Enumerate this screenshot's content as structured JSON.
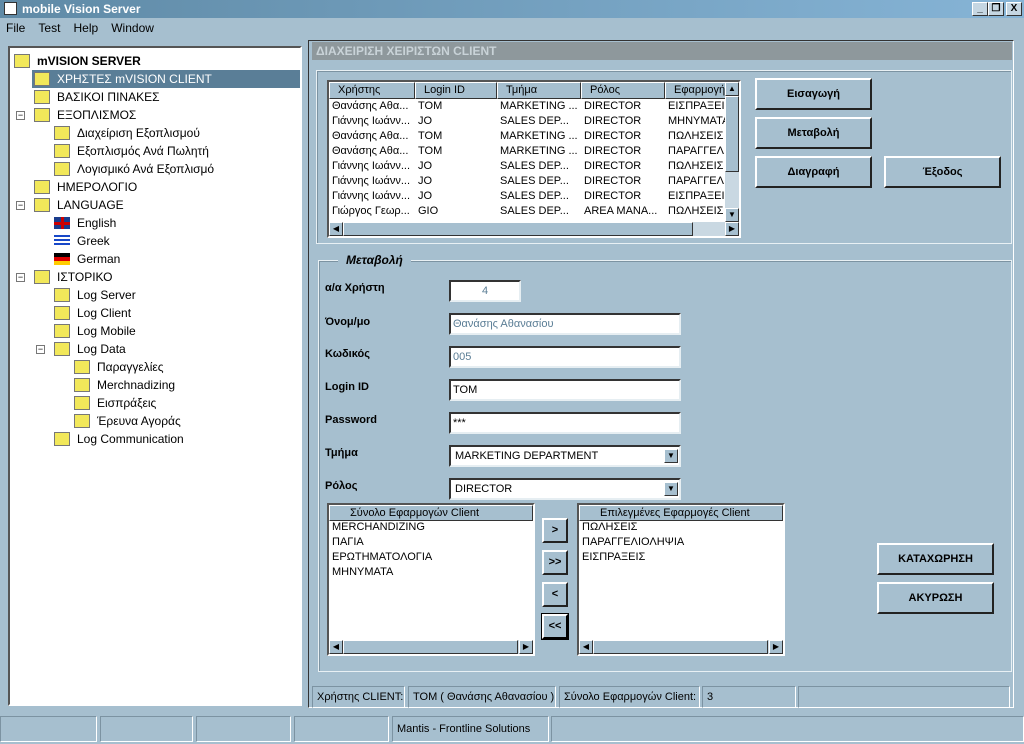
{
  "window": {
    "title": "mobile Vision Server",
    "controls": [
      "_",
      "Ɖ",
      "X"
    ]
  },
  "menu": [
    "File",
    "Test",
    "Help",
    "Window"
  ],
  "tree": [
    {
      "label": "mVISION SERVER",
      "level": 0,
      "bold": true,
      "icon": "folder"
    },
    {
      "label": "ΧΡΗΣΤΕΣ mVISION CLIENT",
      "level": 1,
      "icon": "folder",
      "selected": true
    },
    {
      "label": "ΒΑΣΙΚΟΙ ΠΙΝΑΚΕΣ",
      "level": 1,
      "icon": "folder"
    },
    {
      "label": "ΕΞΟΠΛΙΣΜΟΣ",
      "level": 1,
      "icon": "folder",
      "expanded": true
    },
    {
      "label": "Διαχείριση Εξοπλισμού",
      "level": 2,
      "icon": "folder"
    },
    {
      "label": "Εξοπλισμός Ανά Πωλητή",
      "level": 2,
      "icon": "folder"
    },
    {
      "label": "Λογισμικό Ανά Εξοπλισμό",
      "level": 2,
      "icon": "folder"
    },
    {
      "label": "ΗΜΕΡΟΛΟΓΙΟ",
      "level": 1,
      "icon": "folder"
    },
    {
      "label": "LANGUAGE",
      "level": 1,
      "icon": "folder",
      "expanded": true
    },
    {
      "label": "English",
      "level": 2,
      "icon": "flag-uk"
    },
    {
      "label": "Greek",
      "level": 2,
      "icon": "flag-greece"
    },
    {
      "label": "German",
      "level": 2,
      "icon": "flag-germany"
    },
    {
      "label": "ΙΣΤΟΡΙΚΟ",
      "level": 1,
      "icon": "folder",
      "expanded": true
    },
    {
      "label": "Log Server",
      "level": 2,
      "icon": "folder"
    },
    {
      "label": "Log Client",
      "level": 2,
      "icon": "folder"
    },
    {
      "label": "Log Mobile",
      "level": 2,
      "icon": "folder"
    },
    {
      "label": "Log Data",
      "level": 2,
      "icon": "folder",
      "expanded": true
    },
    {
      "label": "Παραγγελίες",
      "level": 3,
      "icon": "folder"
    },
    {
      "label": "Merchnadizing",
      "level": 3,
      "icon": "folder"
    },
    {
      "label": "Εισπράξεις",
      "level": 3,
      "icon": "folder"
    },
    {
      "label": "Έρευνα Αγοράς",
      "level": 3,
      "icon": "folder"
    },
    {
      "label": "Log Communication",
      "level": 2,
      "icon": "folder"
    }
  ],
  "header": "ΔΙΑΧΕΙΡΙΣΗ ΧΕΙΡΙΣΤΩΝ CLIENT",
  "table": {
    "columns": [
      "Χρήστης",
      "Login ID",
      "Τμήμα",
      "Ρόλος",
      "Εφαρμογή C"
    ],
    "rows": [
      [
        "Θανάσης Αθα...",
        "TOM",
        "MARKETING ...",
        "DIRECTOR",
        "ΕΙΣΠΡΑΞΕΙΣ"
      ],
      [
        "Γιάννης Ιωάνν...",
        "JO",
        "SALES DEP...",
        "DIRECTOR",
        "ΜΗΝΥΜΑΤΑ"
      ],
      [
        "Θανάσης Αθα...",
        "TOM",
        "MARKETING ...",
        "DIRECTOR",
        "ΠΩΛΗΣΕΙΣ"
      ],
      [
        "Θανάσης Αθα...",
        "TOM",
        "MARKETING ...",
        "DIRECTOR",
        "ΠΑΡΑΓΓΕΛΙ"
      ],
      [
        "Γιάννης Ιωάνν...",
        "JO",
        "SALES DEP...",
        "DIRECTOR",
        "ΠΩΛΗΣΕΙΣ"
      ],
      [
        "Γιάννης Ιωάνν...",
        "JO",
        "SALES DEP...",
        "DIRECTOR",
        "ΠΑΡΑΓΓΕΛΙ"
      ],
      [
        "Γιάννης Ιωάνν...",
        "JO",
        "SALES DEP...",
        "DIRECTOR",
        "ΕΙΣΠΡΑΞΕΙΣ"
      ],
      [
        "Γιώργος Γεωρ...",
        "GIO",
        "SALES DEP...",
        "AREA MANA...",
        "ΠΩΛΗΣΕΙΣ"
      ]
    ]
  },
  "actions": {
    "insert": "Εισαγωγή",
    "modify": "Μεταβολή",
    "delete": "Διαγραφή",
    "exit": "Έξοδος"
  },
  "form": {
    "legend": "Μεταβολή",
    "user_no_label": "α/α Χρήστη",
    "user_no": "4",
    "name_label": "Όνομ/μο",
    "name": "Θανάσης Αθανασίου",
    "code_label": "Κωδικός",
    "code": "005",
    "login_label": "Login ID",
    "login": "TOM",
    "password_label": "Password",
    "password": "***",
    "dept_label": "Τμήμα",
    "dept": "MARKETING DEPARTMENT",
    "role_label": "Ρόλος",
    "role": "DIRECTOR"
  },
  "apps": {
    "all_header": "Σύνολο Εφαρμογών Client",
    "all": [
      "MERCHANDIZING",
      "ΠΑΓΙΑ",
      "ΕΡΩΤΗΜΑΤΟΛΟΓΙΑ",
      "ΜΗΝΥΜΑΤΑ"
    ],
    "selected_header": "Επιλεγμένες Εφαρμογές Client",
    "selected": [
      "ΠΩΛΗΣΕΙΣ",
      "ΠΑΡΑΓΓΕΛΙΟΛΗΨΙΑ",
      "ΕΙΣΠΡΑΞΕΙΣ"
    ],
    "add": ">",
    "add_all": ">>",
    "remove": "<",
    "remove_all": "<<"
  },
  "save": "ΚΑΤΑΧΩΡΗΣΗ",
  "cancel": "ΑΚΥΡΩΣΗ",
  "status": {
    "user_label": "Χρήστης CLIENT:",
    "user": "TOM ( Θανάσης Αθανασίου )",
    "apps_label": "Σύνολο Εφαρμογών Client:",
    "apps_count": "3"
  },
  "footer": {
    "company": "Mantis - Frontline Solutions"
  }
}
